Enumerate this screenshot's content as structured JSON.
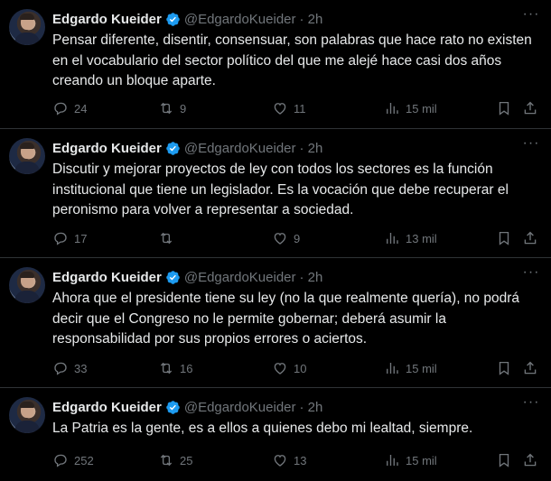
{
  "tweets": [
    {
      "author": "Edgardo Kueider",
      "handle": "@EdgardoKueider",
      "time": "· 2h",
      "text": "Pensar diferente, disentir, consensuar, son palabras que hace rato no existen en el vocabulario del sector político del que me alejé hace casi dos años creando un bloque aparte.",
      "replies": "24",
      "reposts": "9",
      "likes": "11",
      "views": "15 mil"
    },
    {
      "author": "Edgardo Kueider",
      "handle": "@EdgardoKueider",
      "time": "· 2h",
      "text": "Discutir y mejorar proyectos de ley con todos los sectores es la función institucional que tiene un legislador. Es la vocación que debe recuperar el peronismo para volver a representar a sociedad.",
      "replies": "17",
      "reposts": "",
      "likes": "9",
      "views": "13 mil"
    },
    {
      "author": "Edgardo Kueider",
      "handle": "@EdgardoKueider",
      "time": "· 2h",
      "text": "Ahora que el presidente tiene su ley (no la que realmente quería), no podrá decir que el Congreso no le permite gobernar; deberá asumir la responsabilidad por sus propios errores o aciertos.",
      "replies": "33",
      "reposts": "16",
      "likes": "10",
      "views": "15 mil"
    },
    {
      "author": "Edgardo Kueider",
      "handle": "@EdgardoKueider",
      "time": "· 2h",
      "text": "La Patria es la gente, es a ellos a quienes debo mi lealtad, siempre.",
      "replies": "252",
      "reposts": "25",
      "likes": "13",
      "views": "15 mil"
    }
  ],
  "icons": {
    "reply": "reply-icon",
    "repost": "repost-icon",
    "like": "heart-icon",
    "views": "views-icon",
    "bookmark": "bookmark-icon",
    "share": "share-icon",
    "verified": "verified-badge-icon",
    "more": "more-icon"
  },
  "colors": {
    "background": "#000000",
    "text": "#e7e9ea",
    "muted": "#71767b",
    "verified": "#1d9bf0",
    "divider": "#2f3336"
  }
}
